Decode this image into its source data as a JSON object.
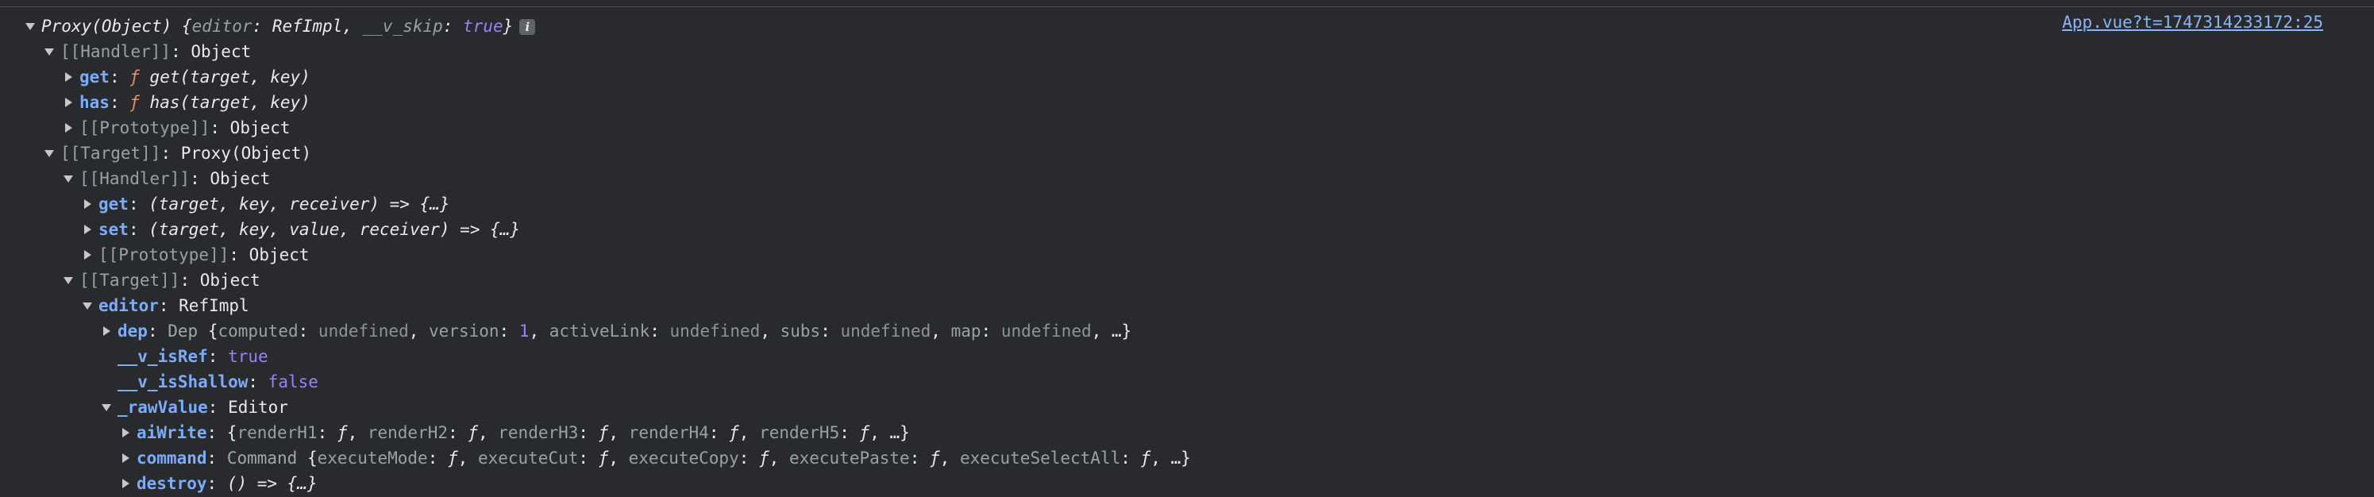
{
  "source_link": "App.vue?t=1747314233172:25",
  "info_icon": "info-icon",
  "lines": {
    "l0": {
      "head": "Proxy(Object) {",
      "k1": "editor",
      "v1": "RefImpl",
      "k2": "__v_skip",
      "v2": "true",
      "tail": "}"
    },
    "l1": {
      "key": "[[Handler]]",
      "val": "Object"
    },
    "l2": {
      "key": "get",
      "f": "ƒ",
      "sig": "get(target, key)"
    },
    "l3": {
      "key": "has",
      "f": "ƒ",
      "sig": "has(target, key)"
    },
    "l4": {
      "key": "[[Prototype]]",
      "val": "Object"
    },
    "l5": {
      "key": "[[Target]]",
      "val": "Proxy(Object)"
    },
    "l6": {
      "key": "[[Handler]]",
      "val": "Object"
    },
    "l7": {
      "key": "get",
      "sig": "(target, key, receiver) => {…}"
    },
    "l8": {
      "key": "set",
      "sig": "(target, key, value, receiver) => {…}"
    },
    "l9": {
      "key": "[[Prototype]]",
      "val": "Object"
    },
    "l10": {
      "key": "[[Target]]",
      "val": "Object"
    },
    "l11": {
      "key": "editor",
      "val": "RefImpl"
    },
    "l12": {
      "key": "dep",
      "cls": "Dep",
      "p1k": "computed",
      "p1v": "undefined",
      "p2k": "version",
      "p2v": "1",
      "p3k": "activeLink",
      "p3v": "undefined",
      "p4k": "subs",
      "p4v": "undefined",
      "p5k": "map",
      "p5v": "undefined",
      "more": "…}"
    },
    "l13": {
      "key": "__v_isRef",
      "val": "true"
    },
    "l14": {
      "key": "__v_isShallow",
      "val": "false"
    },
    "l15": {
      "key": "_rawValue",
      "val": "Editor"
    },
    "l16": {
      "key": "aiWrite",
      "p1": "renderH1",
      "p2": "renderH2",
      "p3": "renderH3",
      "p4": "renderH4",
      "p5": "renderH5",
      "f": "ƒ",
      "more": "…}"
    },
    "l17": {
      "key": "command",
      "cls": "Command",
      "p1": "executeMode",
      "p2": "executeCut",
      "p3": "executeCopy",
      "p4": "executePaste",
      "p5": "executeSelectAll",
      "f": "ƒ",
      "more": "…}"
    },
    "l18": {
      "key": "destroy",
      "sig": "() => {…}"
    }
  }
}
